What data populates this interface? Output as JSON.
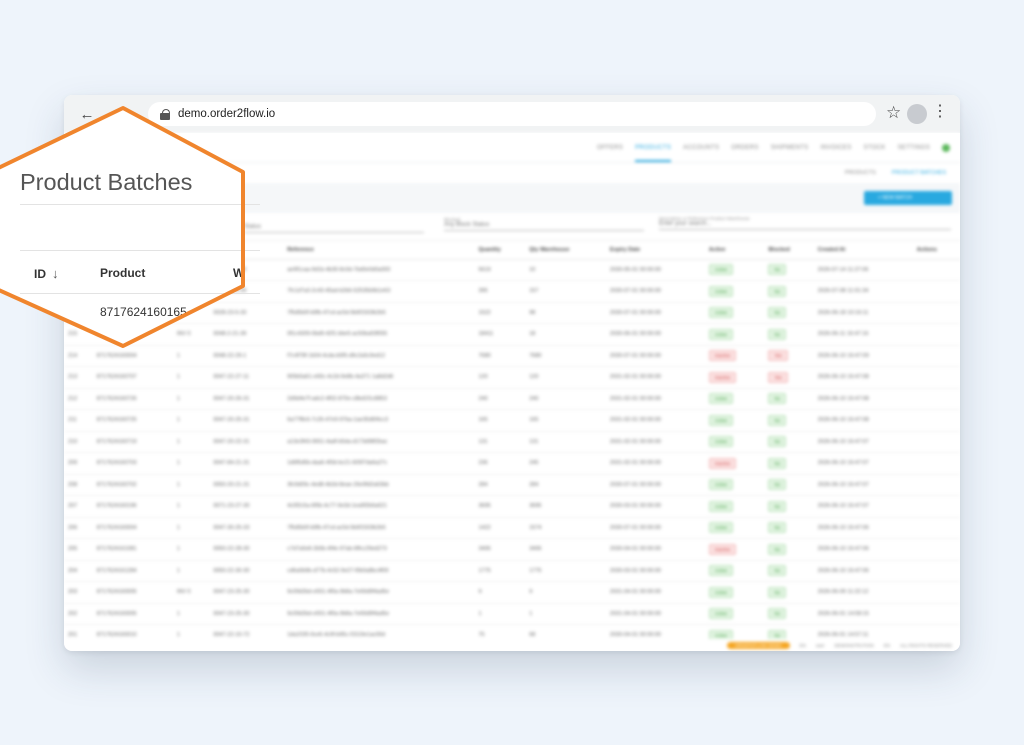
{
  "browser": {
    "back_icon": "arrow-left-icon",
    "forward_icon": "arrow-right-icon",
    "url": "demo.order2flow.io"
  },
  "app": {
    "top_nav": [
      "OFFERS",
      "PRODUCTS",
      "ACCOUNTS",
      "ORDERS",
      "SHIPMENTS",
      "INVOICES",
      "STOCK",
      "SETTINGS"
    ],
    "top_nav_active": 1,
    "sub_nav": [
      "PRODUCTS",
      "PRODUCT BATCHES"
    ],
    "sub_nav_active": 1,
    "new_batch_label": "+ NEW BATCH",
    "filters": {
      "status_label": "Status",
      "block_status_label": "Blocked",
      "block_status_value": "Any Block Status",
      "search_label": "Description or Reference Product Warehouse",
      "search_placeholder": "Enter your search..."
    },
    "columns": [
      "ID",
      "Product",
      "W",
      "Batch #",
      "Reference",
      "Quantity",
      "Qty Warehouse",
      "Expiry Date",
      "Active",
      "Blocked",
      "Created At",
      "Actions"
    ],
    "rows": [
      {
        "id": "",
        "product": "",
        "w": "",
        "batch": "0020-23-3-30",
        "ref": "ae9f1caa-9d1b-4b30-8c0d-7bd0e0d0a000",
        "qty": "5619",
        "qtyw": "10",
        "expiry": "2030-05-01 00:00:00",
        "active": "ok",
        "blocked": "ok",
        "created": "2026-07-14 11:27:06"
      },
      {
        "id": "",
        "product": "",
        "w": "",
        "batch": "0030-23-5-39",
        "ref": "7fc1d7a3-2c43-45ad-b2b6-52535b9b1e63",
        "qty": "395",
        "qtyw": "157",
        "expiry": "2030-07-01 00:00:00",
        "active": "ok",
        "blocked": "ok",
        "created": "2026-07-08 11:01:34"
      },
      {
        "id": "",
        "product": "",
        "w": "",
        "batch": "0028-23-5-33",
        "ref": "7f5d5b0f-b9fb-47cd-ac5d-5b6f1503b2b5",
        "qty": "1522",
        "qtyw": "98",
        "expiry": "2030-07-01 00:00:00",
        "active": "ok",
        "blocked": "ok",
        "created": "2026-06-18 10:16:11"
      },
      {
        "id": "215",
        "product": "8717624160165",
        "w": "INV 0",
        "batch": "0048-2-21-39",
        "ref": "0f1c4309-0bd9-42f1-bbe5-ac50ba93f055",
        "qty": "18411",
        "qtyw": "18",
        "expiry": "2030-06-01 00:00:00",
        "active": "ok",
        "blocked": "ok",
        "created": "2026-06-11 16:47:16"
      },
      {
        "id": "214",
        "product": "8717624160004",
        "w": "1",
        "batch": "0048-22-29-1",
        "ref": "f7c4f78f-1b54-4cda-b5f5-d9c2a5c9ed12",
        "qty": "7680",
        "qtyw": "7680",
        "expiry": "2030-07-01 00:00:00",
        "active": "bad",
        "blocked": "bad",
        "created": "2026-06-10 16:47:09"
      },
      {
        "id": "213",
        "product": "8717624160707",
        "w": "1",
        "batch": "0047-22-27-11",
        "ref": "905b5a61-e60c-4c2d-9e8b-4a371 1a8d2d6",
        "qty": "120",
        "qtyw": "120",
        "expiry": "2031-02-01 00:00:00",
        "active": "bad",
        "blocked": "bad",
        "created": "2026-06-10 16:47:08"
      },
      {
        "id": "212",
        "product": "8717624160726",
        "w": "1",
        "batch": "0047-20-26-31",
        "ref": "2d9d4e7f-adc2-4f02-870e-c8bd1f1c8853",
        "qty": "240",
        "qtyw": "240",
        "expiry": "2031-02-01 00:00:00",
        "active": "ok",
        "blocked": "ok",
        "created": "2026-06-10 16:47:08"
      },
      {
        "id": "211",
        "product": "8717624160725",
        "w": "1",
        "batch": "0047-20-25-31",
        "ref": "6a77f8c6-7c26-47e9-97ba-1ae35d6f4cc3",
        "qty": "165",
        "qtyw": "165",
        "expiry": "2031-02-01 00:00:00",
        "active": "ok",
        "blocked": "ok",
        "created": "2026-06-10 16:47:08"
      },
      {
        "id": "210",
        "product": "8717624160719",
        "w": "1",
        "batch": "0047-20-22-31",
        "ref": "a13e3f43-0651-4adf-b5da-d173d98f2bac",
        "qty": "131",
        "qtyw": "131",
        "expiry": "2031-02-01 00:00:00",
        "active": "ok",
        "blocked": "ok",
        "created": "2026-06-10 16:47:07"
      },
      {
        "id": "209",
        "product": "8717624160703",
        "w": "1",
        "batch": "0047-84-21-31",
        "ref": "1d6f5d5b-daa6-4f3d-bc21-605f7da6a27c",
        "qty": "236",
        "qtyw": "245",
        "expiry": "2031-02-01 00:00:00",
        "active": "bad",
        "blocked": "ok",
        "created": "2026-06-10 16:47:07"
      },
      {
        "id": "208",
        "product": "8717624160702",
        "w": "1",
        "batch": "0050-20-21-31",
        "ref": "3fc9d09c-4ed8-4b3d-8eae-26e9fd2a63bb",
        "qty": "284",
        "qtyw": "284",
        "expiry": "2030-07-01 00:00:00",
        "active": "ok",
        "blocked": "ok",
        "created": "2026-06-10 16:47:07"
      },
      {
        "id": "207",
        "product": "8717624160196",
        "w": "1",
        "batch": "0071-23-27-30",
        "ref": "4c0f2c5a-6f5b-4c77-9e3d-1ea9f2b6a621",
        "qty": "3695",
        "qtyw": "3695",
        "expiry": "2030-03-01 00:00:00",
        "active": "ok",
        "blocked": "ok",
        "created": "2026-06-10 16:47:07"
      },
      {
        "id": "206",
        "product": "8717624160004",
        "w": "1",
        "batch": "0047-30-25-33",
        "ref": "7f5d5b0f-b9fb-47cd-ac5d-5b6f1503b2b5",
        "qty": "1422",
        "qtyw": "1574",
        "expiry": "2030-07-01 00:00:00",
        "active": "ok",
        "blocked": "ok",
        "created": "2026-06-10 16:47:06"
      },
      {
        "id": "205",
        "product": "8717624161081",
        "w": "1",
        "batch": "0050-22-28-30",
        "ref": "c7d7a5e8-2b5b-4f4e-97ab-6ffcc29ed273",
        "qty": "3406",
        "qtyw": "3406",
        "expiry": "2030-04-01 00:00:00",
        "active": "bad",
        "blocked": "ok",
        "created": "2026-06-10 16:47:06"
      },
      {
        "id": "204",
        "product": "8717624161284",
        "w": "1",
        "batch": "0050-22-30-30",
        "ref": "cd6a0b9b-d77b-4c52-9e27-f0b0a8bc4f09",
        "qty": "1775",
        "qtyw": "1775",
        "expiry": "2030-03-01 00:00:00",
        "active": "ok",
        "blocked": "ok",
        "created": "2026-06-10 16:47:06"
      },
      {
        "id": "203",
        "product": "8717624160005",
        "w": "INV 0",
        "batch": "0047-23-25-30",
        "ref": "9c09d2bd-e551-4f0a-9b8a-7e69d9f4ad5e",
        "qty": "9",
        "qtyw": "9",
        "expiry": "2031-04-01 00:00:00",
        "active": "ok",
        "blocked": "ok",
        "created": "2026-06-09 11:22:12"
      },
      {
        "id": "202",
        "product": "8717624160005",
        "w": "1",
        "batch": "0047-23-25-30",
        "ref": "9c09d2bd-e551-4f0a-9b8a-7e69d9f4ad5e",
        "qty": "1",
        "qtyw": "1",
        "expiry": "2031-04-01 00:00:00",
        "active": "ok",
        "blocked": "ok",
        "created": "2026-06-01 14:58:15"
      },
      {
        "id": "201",
        "product": "8717624160010",
        "w": "1",
        "batch": "0047-22-10-72",
        "ref": "1da1f1f0-0ce6-4c9f-b95c-f1519e1ac00d",
        "qty": "75",
        "qtyw": "68",
        "expiry": "2030-04-01 00:00:00",
        "active": "ok",
        "blocked": "ok",
        "created": "2026-06-01 14:57:11"
      }
    ],
    "status_labels": {
      "ok": "Active",
      "bad": "Inactive",
      "ok_blocked": "No",
      "bad_blocked": "Yes"
    },
    "footer": {
      "badge": "ORDER2FLOW DEMO",
      "items": [
        "EN",
        "user",
        "DEMONSTRATION",
        "EN",
        "ALL RIGHTS RESERVED"
      ]
    }
  },
  "zoom": {
    "title": "Product Batches",
    "col_id": "ID",
    "sort_icon": "arrow-down-icon",
    "col_product": "Product",
    "col_w": "W",
    "first_product": "8717624160165"
  },
  "colors": {
    "accent": "#29a9e0",
    "highlight": "#f0852d",
    "background": "#eef4fb"
  }
}
